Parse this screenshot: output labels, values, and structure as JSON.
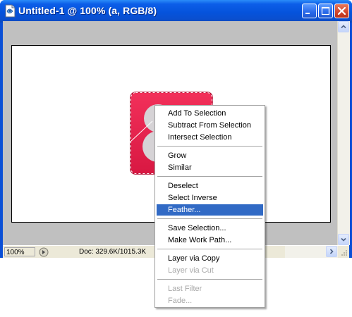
{
  "window": {
    "title": "Untitled-1 @ 100% (a, RGB/8)",
    "controls": [
      "minimize",
      "maximize",
      "close"
    ]
  },
  "status": {
    "zoom": "100%",
    "doc_info": "Doc: 329.6K/1015.3K"
  },
  "context_menu": {
    "items": [
      {
        "label": "Add To Selection",
        "state": "enabled"
      },
      {
        "label": "Subtract From Selection",
        "state": "enabled"
      },
      {
        "label": "Intersect Selection",
        "state": "enabled"
      },
      {
        "label": "Grow",
        "state": "enabled"
      },
      {
        "label": "Similar",
        "state": "enabled"
      },
      {
        "label": "Deselect",
        "state": "enabled"
      },
      {
        "label": "Select Inverse",
        "state": "enabled"
      },
      {
        "label": "Feather...",
        "state": "highlighted"
      },
      {
        "label": "Save Selection...",
        "state": "enabled"
      },
      {
        "label": "Make Work Path...",
        "state": "enabled"
      },
      {
        "label": "Layer via Copy",
        "state": "enabled"
      },
      {
        "label": "Layer via Cut",
        "state": "disabled"
      },
      {
        "label": "Last Filter",
        "state": "disabled"
      },
      {
        "label": "Fade...",
        "state": "disabled"
      }
    ]
  },
  "colors": {
    "title_bar": "#0553dc",
    "menu_highlight": "#316ac5",
    "artwork_fill": "#e8244e",
    "canvas_background": "#c0c0c0"
  }
}
